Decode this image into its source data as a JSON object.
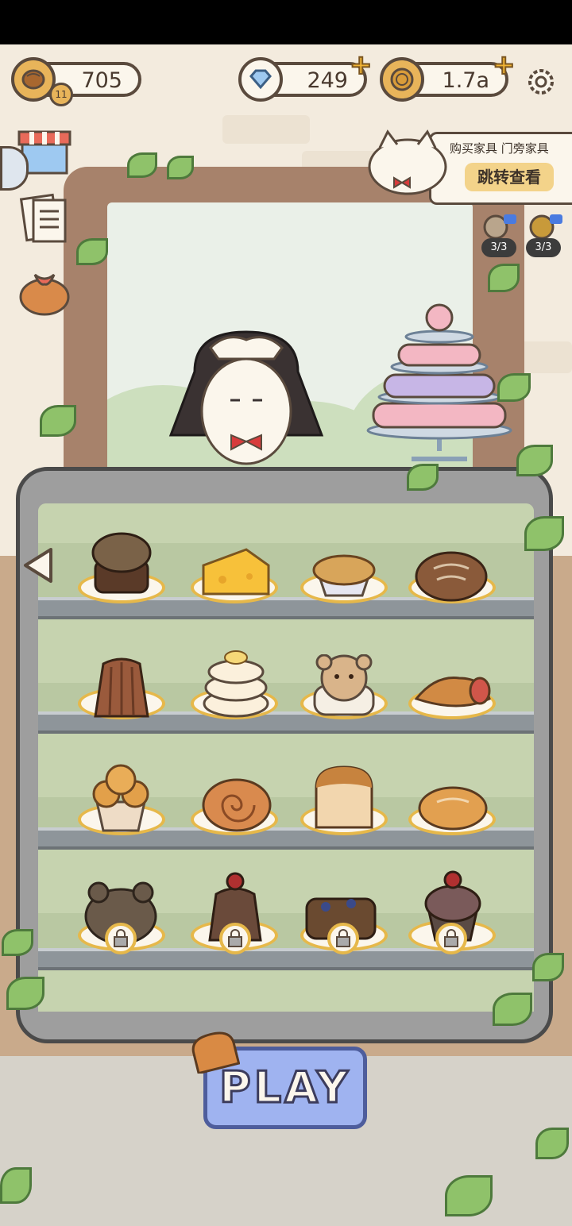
{
  "top_bar": {
    "bread_count": "705",
    "bread_level": "11",
    "diamonds": "249",
    "coins": "1.7a"
  },
  "promo": {
    "caption": "购买家具  门旁家具",
    "button": "跳转查看"
  },
  "boosts": [
    {
      "count": "3/3"
    },
    {
      "count": "3/3"
    }
  ],
  "play_button": "PLAY",
  "colors": {
    "accent_gold": "#e6b84a",
    "play_blue": "#9fb3f0",
    "wall": "#f3ebde",
    "case_frame": "#9e9e9e"
  }
}
